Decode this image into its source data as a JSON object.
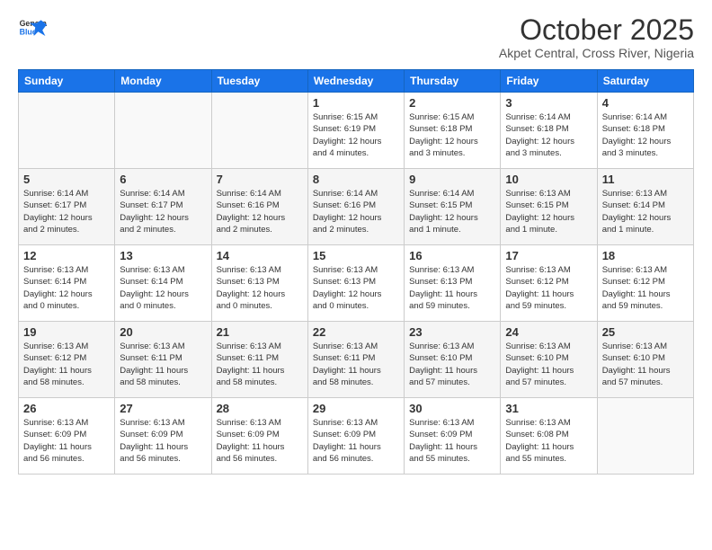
{
  "header": {
    "logo_general": "General",
    "logo_blue": "Blue",
    "month_title": "October 2025",
    "subtitle": "Akpet Central, Cross River, Nigeria"
  },
  "weekdays": [
    "Sunday",
    "Monday",
    "Tuesday",
    "Wednesday",
    "Thursday",
    "Friday",
    "Saturday"
  ],
  "weeks": [
    [
      {
        "day": "",
        "info": ""
      },
      {
        "day": "",
        "info": ""
      },
      {
        "day": "",
        "info": ""
      },
      {
        "day": "1",
        "info": "Sunrise: 6:15 AM\nSunset: 6:19 PM\nDaylight: 12 hours\nand 4 minutes."
      },
      {
        "day": "2",
        "info": "Sunrise: 6:15 AM\nSunset: 6:18 PM\nDaylight: 12 hours\nand 3 minutes."
      },
      {
        "day": "3",
        "info": "Sunrise: 6:14 AM\nSunset: 6:18 PM\nDaylight: 12 hours\nand 3 minutes."
      },
      {
        "day": "4",
        "info": "Sunrise: 6:14 AM\nSunset: 6:18 PM\nDaylight: 12 hours\nand 3 minutes."
      }
    ],
    [
      {
        "day": "5",
        "info": "Sunrise: 6:14 AM\nSunset: 6:17 PM\nDaylight: 12 hours\nand 2 minutes."
      },
      {
        "day": "6",
        "info": "Sunrise: 6:14 AM\nSunset: 6:17 PM\nDaylight: 12 hours\nand 2 minutes."
      },
      {
        "day": "7",
        "info": "Sunrise: 6:14 AM\nSunset: 6:16 PM\nDaylight: 12 hours\nand 2 minutes."
      },
      {
        "day": "8",
        "info": "Sunrise: 6:14 AM\nSunset: 6:16 PM\nDaylight: 12 hours\nand 2 minutes."
      },
      {
        "day": "9",
        "info": "Sunrise: 6:14 AM\nSunset: 6:15 PM\nDaylight: 12 hours\nand 1 minute."
      },
      {
        "day": "10",
        "info": "Sunrise: 6:13 AM\nSunset: 6:15 PM\nDaylight: 12 hours\nand 1 minute."
      },
      {
        "day": "11",
        "info": "Sunrise: 6:13 AM\nSunset: 6:14 PM\nDaylight: 12 hours\nand 1 minute."
      }
    ],
    [
      {
        "day": "12",
        "info": "Sunrise: 6:13 AM\nSunset: 6:14 PM\nDaylight: 12 hours\nand 0 minutes."
      },
      {
        "day": "13",
        "info": "Sunrise: 6:13 AM\nSunset: 6:14 PM\nDaylight: 12 hours\nand 0 minutes."
      },
      {
        "day": "14",
        "info": "Sunrise: 6:13 AM\nSunset: 6:13 PM\nDaylight: 12 hours\nand 0 minutes."
      },
      {
        "day": "15",
        "info": "Sunrise: 6:13 AM\nSunset: 6:13 PM\nDaylight: 12 hours\nand 0 minutes."
      },
      {
        "day": "16",
        "info": "Sunrise: 6:13 AM\nSunset: 6:13 PM\nDaylight: 11 hours\nand 59 minutes."
      },
      {
        "day": "17",
        "info": "Sunrise: 6:13 AM\nSunset: 6:12 PM\nDaylight: 11 hours\nand 59 minutes."
      },
      {
        "day": "18",
        "info": "Sunrise: 6:13 AM\nSunset: 6:12 PM\nDaylight: 11 hours\nand 59 minutes."
      }
    ],
    [
      {
        "day": "19",
        "info": "Sunrise: 6:13 AM\nSunset: 6:12 PM\nDaylight: 11 hours\nand 58 minutes."
      },
      {
        "day": "20",
        "info": "Sunrise: 6:13 AM\nSunset: 6:11 PM\nDaylight: 11 hours\nand 58 minutes."
      },
      {
        "day": "21",
        "info": "Sunrise: 6:13 AM\nSunset: 6:11 PM\nDaylight: 11 hours\nand 58 minutes."
      },
      {
        "day": "22",
        "info": "Sunrise: 6:13 AM\nSunset: 6:11 PM\nDaylight: 11 hours\nand 58 minutes."
      },
      {
        "day": "23",
        "info": "Sunrise: 6:13 AM\nSunset: 6:10 PM\nDaylight: 11 hours\nand 57 minutes."
      },
      {
        "day": "24",
        "info": "Sunrise: 6:13 AM\nSunset: 6:10 PM\nDaylight: 11 hours\nand 57 minutes."
      },
      {
        "day": "25",
        "info": "Sunrise: 6:13 AM\nSunset: 6:10 PM\nDaylight: 11 hours\nand 57 minutes."
      }
    ],
    [
      {
        "day": "26",
        "info": "Sunrise: 6:13 AM\nSunset: 6:09 PM\nDaylight: 11 hours\nand 56 minutes."
      },
      {
        "day": "27",
        "info": "Sunrise: 6:13 AM\nSunset: 6:09 PM\nDaylight: 11 hours\nand 56 minutes."
      },
      {
        "day": "28",
        "info": "Sunrise: 6:13 AM\nSunset: 6:09 PM\nDaylight: 11 hours\nand 56 minutes."
      },
      {
        "day": "29",
        "info": "Sunrise: 6:13 AM\nSunset: 6:09 PM\nDaylight: 11 hours\nand 56 minutes."
      },
      {
        "day": "30",
        "info": "Sunrise: 6:13 AM\nSunset: 6:09 PM\nDaylight: 11 hours\nand 55 minutes."
      },
      {
        "day": "31",
        "info": "Sunrise: 6:13 AM\nSunset: 6:08 PM\nDaylight: 11 hours\nand 55 minutes."
      },
      {
        "day": "",
        "info": ""
      }
    ]
  ]
}
